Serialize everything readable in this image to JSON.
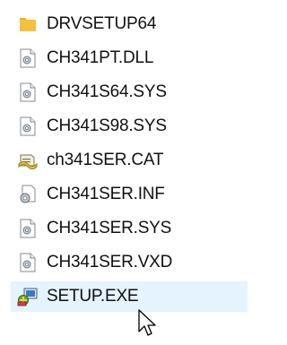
{
  "files": [
    {
      "name": "DRVSETUP64",
      "icon": "folder-icon"
    },
    {
      "name": "CH341PT.DLL",
      "icon": "system-file-icon"
    },
    {
      "name": "CH341S64.SYS",
      "icon": "system-file-icon"
    },
    {
      "name": "CH341S98.SYS",
      "icon": "system-file-icon"
    },
    {
      "name": "ch341SER.CAT",
      "icon": "security-catalog-icon"
    },
    {
      "name": "CH341SER.INF",
      "icon": "setup-information-icon"
    },
    {
      "name": "CH341SER.SYS",
      "icon": "system-file-icon"
    },
    {
      "name": "CH341SER.VXD",
      "icon": "system-file-icon"
    },
    {
      "name": "SETUP.EXE",
      "icon": "setup-exe-icon",
      "selected": true
    }
  ],
  "colors": {
    "folder": "#f3c13e",
    "selection": "#e5f3ff",
    "text": "#111111"
  },
  "cursor": "arrow-cursor-icon"
}
